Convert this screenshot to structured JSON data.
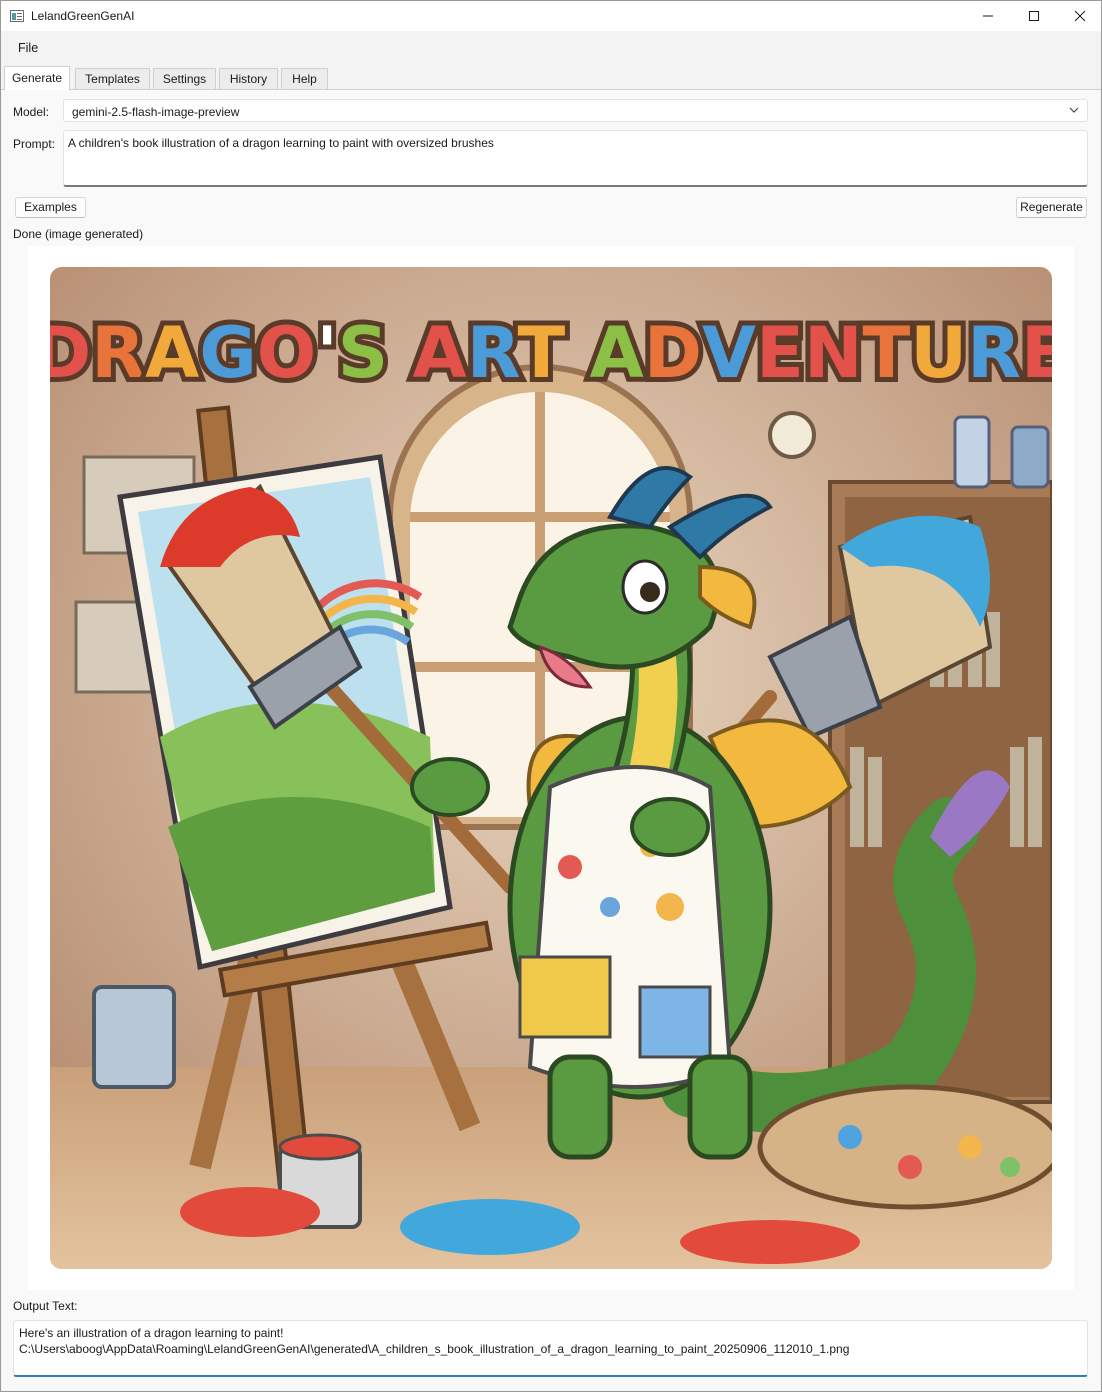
{
  "window": {
    "title": "LelandGreenGenAI"
  },
  "menu": {
    "file": "File"
  },
  "tabs": [
    {
      "label": "Generate",
      "active": true
    },
    {
      "label": "Templates",
      "active": false
    },
    {
      "label": "Settings",
      "active": false
    },
    {
      "label": "History",
      "active": false
    },
    {
      "label": "Help",
      "active": false
    }
  ],
  "generate": {
    "model_label": "Model:",
    "model_value": "gemini-2.5-flash-image-preview",
    "prompt_label": "Prompt:",
    "prompt_value": "A children's book illustration of a dragon learning to paint with oversized brushes",
    "examples_button": "Examples",
    "regenerate_button": "Regenerate",
    "status": "Done (image generated)",
    "image": {
      "title_text": "DRAGO'S ART ADVENTURE",
      "title_letter_colors": [
        "#e2514a",
        "#e8743b",
        "#f0a93a",
        "#4a9bd8",
        "#e2514a",
        "#8cbf45",
        "#e2514a",
        "#4a9bd8",
        "#f0a93a",
        "#8cbf45",
        "#e8743b",
        "#4a9bd8",
        "#e2514a"
      ]
    },
    "output_label": "Output Text:",
    "output_line1": "Here's an illustration of a dragon learning to paint!",
    "output_line2": "C:\\Users\\aboog\\AppData\\Roaming\\LelandGreenGenAI\\generated\\A_children_s_book_illustration_of_a_dragon_learning_to_paint_20250906_112010_1.png"
  },
  "colors": {
    "accent": "#2f7fb3",
    "background": "#f3f3f3"
  }
}
